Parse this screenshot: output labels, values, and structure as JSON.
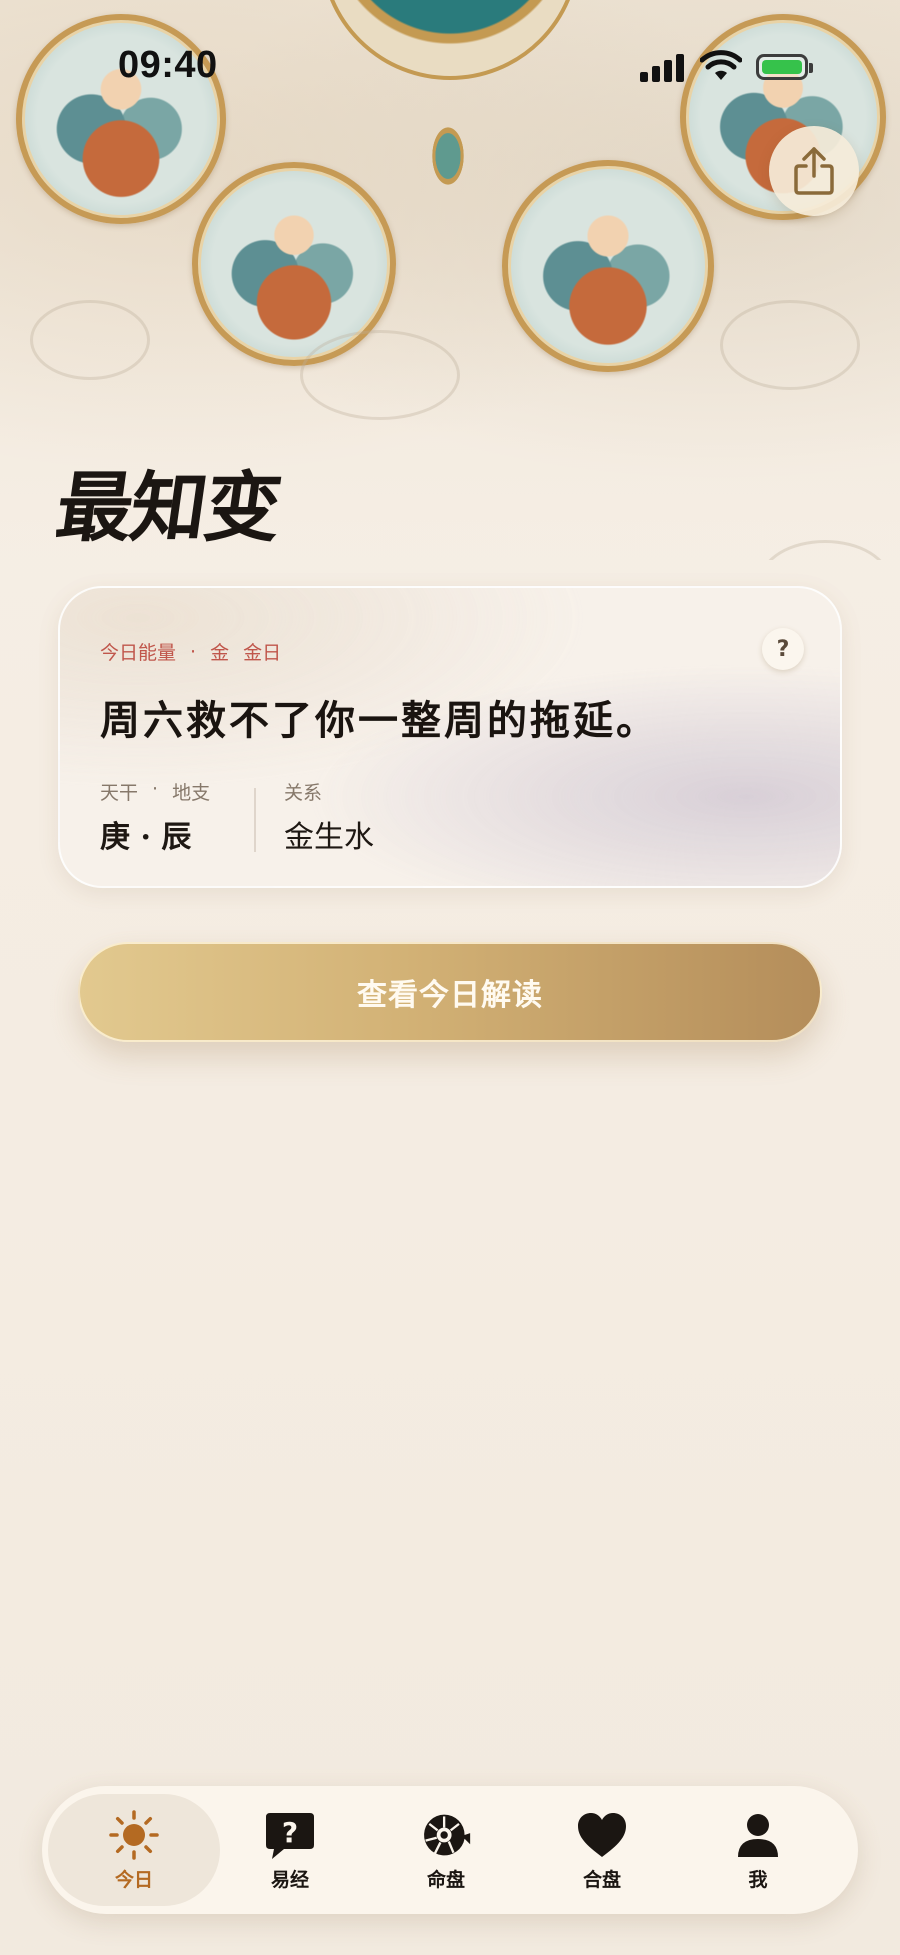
{
  "status_bar": {
    "time": "09:40"
  },
  "brand": {
    "title": "最知变"
  },
  "energy_card": {
    "eyebrow_label": "今日能量",
    "eyebrow_sep": "·",
    "eyebrow_element": "金",
    "eyebrow_day": "金日",
    "help_label": "?",
    "quote": "周六救不了你一整周的拖延。",
    "stem_branch_label": "天干",
    "stem_branch_sep": "·",
    "stem_branch_label2": "地支",
    "stem_branch_value": "庚 · 辰",
    "relation_label": "关系",
    "relation_value": "金生水"
  },
  "cta": {
    "label": "查看今日解读"
  },
  "tabbar": {
    "items": [
      {
        "label": "今日",
        "icon": "sun-icon",
        "active": true
      },
      {
        "label": "易经",
        "icon": "question-bubble-icon",
        "active": false
      },
      {
        "label": "命盘",
        "icon": "nautilus-icon",
        "active": false
      },
      {
        "label": "合盘",
        "icon": "heart-icon",
        "active": false
      },
      {
        "label": "我",
        "icon": "person-icon",
        "active": false
      }
    ]
  },
  "colors": {
    "accent_gold": "#d2b175",
    "accent_brown": "#b46a22",
    "eyebrow_red": "#c0564b",
    "battery_green": "#36c24b"
  }
}
